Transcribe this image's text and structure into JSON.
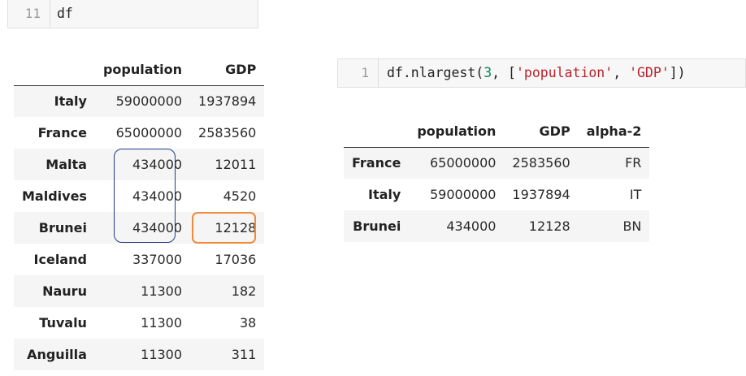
{
  "cell_df": {
    "line_number": "11",
    "code": "df"
  },
  "cell_nlargest": {
    "line_number": "1",
    "code_prefix": "df.nlargest(",
    "code_num": "3",
    "code_sep1": ", [",
    "code_str1": "'population'",
    "code_sep2": ", ",
    "code_str2": "'GDP'",
    "code_suffix": "])"
  },
  "df_table": {
    "columns": [
      "population",
      "GDP"
    ],
    "rows": [
      {
        "index": "Italy",
        "population": "59000000",
        "GDP": "1937894"
      },
      {
        "index": "France",
        "population": "65000000",
        "GDP": "2583560"
      },
      {
        "index": "Malta",
        "population": "434000",
        "GDP": "12011"
      },
      {
        "index": "Maldives",
        "population": "434000",
        "GDP": "4520"
      },
      {
        "index": "Brunei",
        "population": "434000",
        "GDP": "12128"
      },
      {
        "index": "Iceland",
        "population": "337000",
        "GDP": "17036"
      },
      {
        "index": "Nauru",
        "population": "11300",
        "GDP": "182"
      },
      {
        "index": "Tuvalu",
        "population": "11300",
        "GDP": "38"
      },
      {
        "index": "Anguilla",
        "population": "11300",
        "GDP": "311"
      }
    ]
  },
  "result_table": {
    "columns": [
      "population",
      "GDP",
      "alpha-2"
    ],
    "rows": [
      {
        "index": "France",
        "population": "65000000",
        "GDP": "2583560",
        "alpha2": "FR"
      },
      {
        "index": "Italy",
        "population": "59000000",
        "GDP": "1937894",
        "alpha2": "IT"
      },
      {
        "index": "Brunei",
        "population": "434000",
        "GDP": "12128",
        "alpha2": "BN"
      }
    ]
  },
  "highlight_colors": {
    "tied_population": "#1f3c88",
    "gdp_tiebreak": "#f08a3a"
  }
}
